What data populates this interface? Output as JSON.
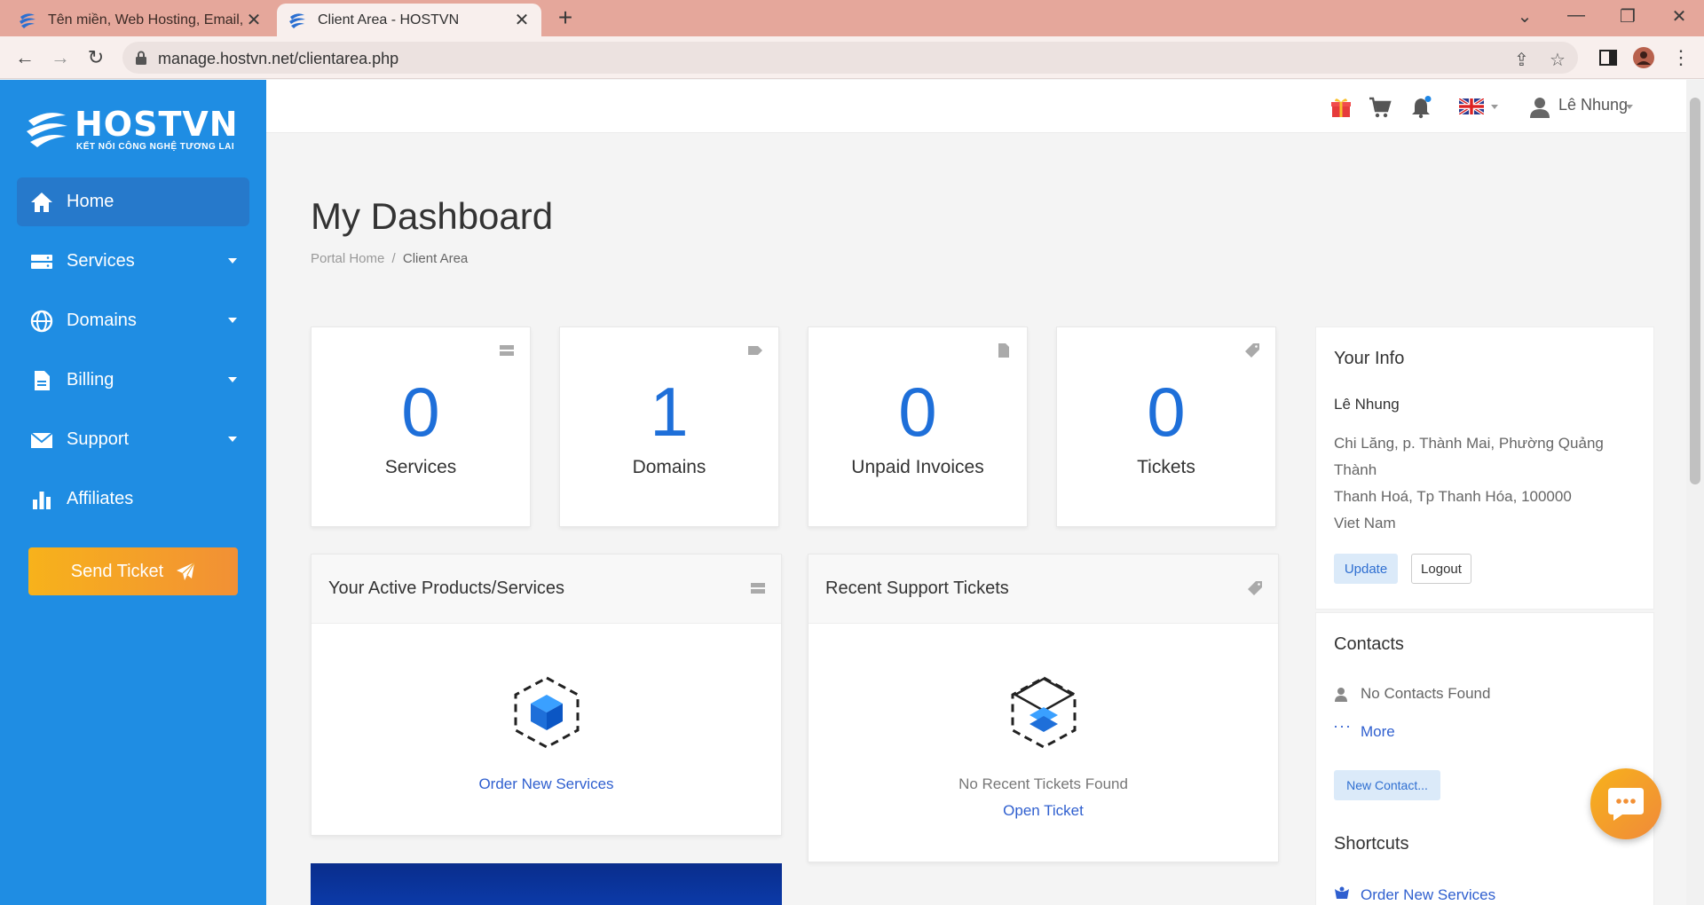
{
  "browser": {
    "tabs": [
      {
        "title": "Tên miền, Web Hosting, Email, VPS",
        "active": false
      },
      {
        "title": "Client Area - HOSTVN",
        "active": true
      }
    ],
    "new_tab": "+",
    "url": "manage.hostvn.net/clientarea.php"
  },
  "brand": {
    "name": "HOSTVN",
    "tagline": "KẾT NỐI CÔNG NGHỆ TƯƠNG LAI"
  },
  "sidebar": {
    "items": [
      {
        "label": "Home",
        "icon": "home-icon",
        "active": true,
        "dropdown": false
      },
      {
        "label": "Services",
        "icon": "server-icon",
        "active": false,
        "dropdown": true
      },
      {
        "label": "Domains",
        "icon": "globe-icon",
        "active": false,
        "dropdown": true
      },
      {
        "label": "Billing",
        "icon": "document-icon",
        "active": false,
        "dropdown": true
      },
      {
        "label": "Support",
        "icon": "envelope-icon",
        "active": false,
        "dropdown": true
      },
      {
        "label": "Affiliates",
        "icon": "bar-chart-icon",
        "active": false,
        "dropdown": false
      }
    ],
    "send_ticket": "Send Ticket"
  },
  "header": {
    "user_name": "Lê Nhung"
  },
  "main": {
    "title": "My Dashboard",
    "breadcrumb": {
      "home": "Portal Home",
      "separator": "/",
      "current": "Client Area"
    },
    "stats": [
      {
        "value": "0",
        "label": "Services"
      },
      {
        "value": "1",
        "label": "Domains"
      },
      {
        "value": "0",
        "label": "Unpaid Invoices"
      },
      {
        "value": "0",
        "label": "Tickets"
      }
    ],
    "products_panel": {
      "title": "Your Active Products/Services",
      "link": "Order New Services"
    },
    "tickets_panel": {
      "title": "Recent Support Tickets",
      "empty": "No Recent Tickets Found",
      "link": "Open Ticket"
    }
  },
  "right": {
    "info": {
      "title": "Your Info",
      "name": "Lê Nhung",
      "address_1": "Chi Lăng, p. Thành Mai, Phường Quảng",
      "address_2": "Thành",
      "address_3": "Thanh Hoá, Tp Thanh Hóa, 100000",
      "country": "Viet Nam",
      "update": "Update",
      "logout": "Logout"
    },
    "contacts": {
      "title": "Contacts",
      "empty": "No Contacts Found",
      "more": "More",
      "new_contact": "New Contact..."
    },
    "shortcuts": {
      "title": "Shortcuts",
      "item": "Order New Services"
    }
  },
  "colors": {
    "sidebar": "#1f8de3",
    "accent_blue": "#1e6fd9",
    "link": "#2f5fcf",
    "orange": "#f29035",
    "tab_bar": "#e5a79b"
  }
}
